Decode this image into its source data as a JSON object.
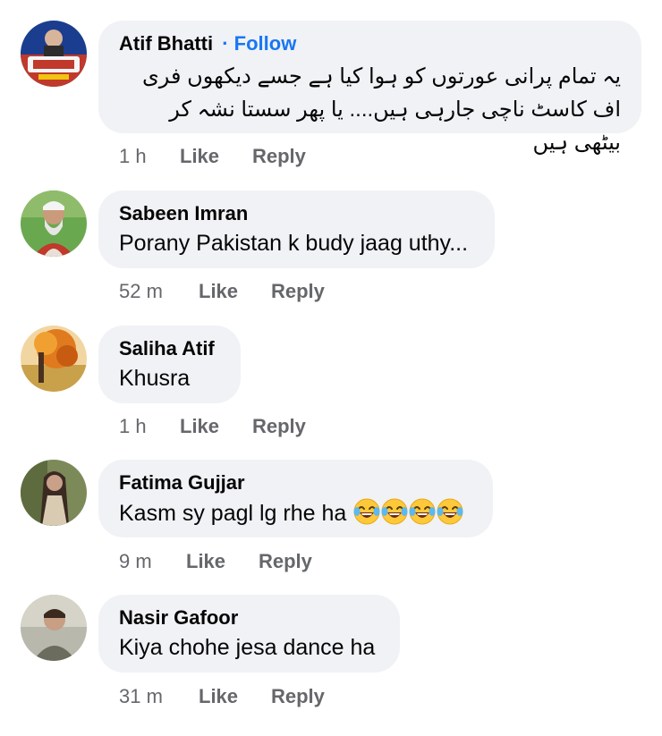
{
  "comments": [
    {
      "author": "Atif Bhatti",
      "follow_dot": "·",
      "follow": "Follow",
      "text": "یہ تمام  پرانی عورتوں کو ہوا کیا  ہے جسے دیکھوں  فری اف کاسٹ ناچی جارہی ہیں.... یا پھر سستا  نشہ کر بیٹھی  ہیں",
      "time": "1 h",
      "like": "Like",
      "reply": "Reply"
    },
    {
      "author": "Sabeen Imran",
      "text": "Porany Pakistan k budy jaag uthy...",
      "time": "52 m",
      "like": "Like",
      "reply": "Reply"
    },
    {
      "author": "Saliha Atif",
      "text": "Khusra",
      "time": "1 h",
      "like": "Like",
      "reply": "Reply"
    },
    {
      "author": "Fatima Gujjar",
      "text": "Kasm sy pagl lg rhe ha",
      "emoji": "face-with-tears-of-joy-icon",
      "emoji_count": 4,
      "time": "9 m",
      "like": "Like",
      "reply": "Reply"
    },
    {
      "author": "Nasir Gafoor",
      "text": "Kiya chohe jesa dance ha",
      "time": "31 m",
      "like": "Like",
      "reply": "Reply"
    }
  ],
  "colors": {
    "bubble": "#f0f2f5",
    "follow": "#1877f2",
    "meta": "#65676b",
    "text": "#050505"
  }
}
